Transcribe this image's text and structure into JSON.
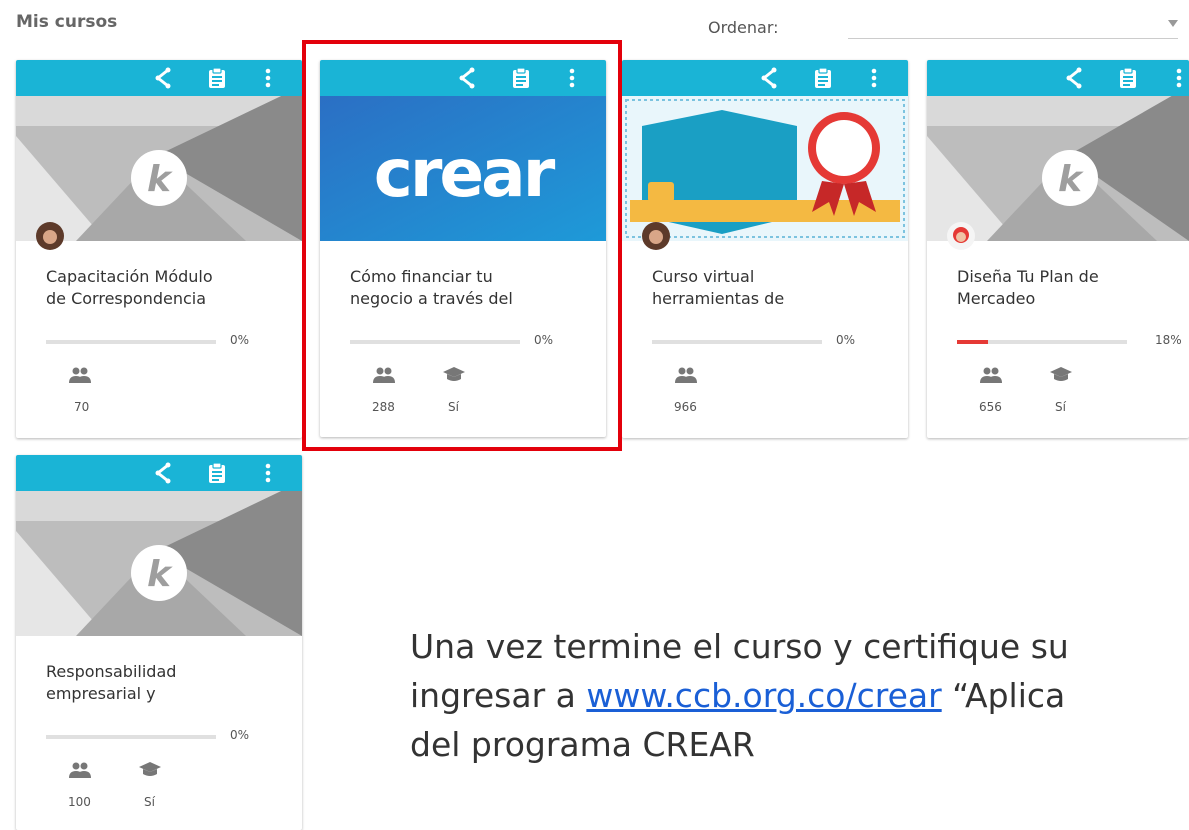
{
  "header": {
    "title": "Mis cursos",
    "sort_label": "Ordenar:",
    "sort_value": ""
  },
  "colors": {
    "toolbar": "#1ab4d6",
    "progress_fill": "#e53935",
    "highlight": "#e3000b",
    "link": "#1a5fd6"
  },
  "card_icons": [
    "share-icon",
    "clipboard-icon",
    "more-vert-icon"
  ],
  "cards": [
    {
      "title_line1": "Capacitación Módulo",
      "title_line2": "de Correspondencia",
      "progress": 0,
      "progress_text": "0%",
      "participants": "70",
      "certificate": "",
      "thumbnail": "k-logo"
    },
    {
      "title_line1": "Cómo financiar tu",
      "title_line2": "negocio a través del",
      "progress": 0,
      "progress_text": "0%",
      "participants": "288",
      "certificate": "Sí",
      "thumbnail": "crear-logo",
      "thumbnail_text": "crear"
    },
    {
      "title_line1": "Curso virtual",
      "title_line2": "herramientas de",
      "progress": 0,
      "progress_text": "0%",
      "participants": "966",
      "certificate": "",
      "thumbnail": "certificate-poster"
    },
    {
      "title_line1": "Diseña Tu Plan de",
      "title_line2": "Mercadeo",
      "progress": 18,
      "progress_text": "18%",
      "participants": "656",
      "certificate": "Sí",
      "thumbnail": "k-logo"
    },
    {
      "title_line1": "Responsabilidad",
      "title_line2": "empresarial y",
      "progress": 0,
      "progress_text": "0%",
      "participants": "100",
      "certificate": "Sí",
      "thumbnail": "k-logo"
    }
  ],
  "caption": {
    "line1": "Una vez termine el curso y certifique su",
    "line2_pre": "ingresar a ",
    "link": "www.ccb.org.co/crear",
    "line2_post": " “Aplica",
    "line3": "del programa CREAR"
  }
}
